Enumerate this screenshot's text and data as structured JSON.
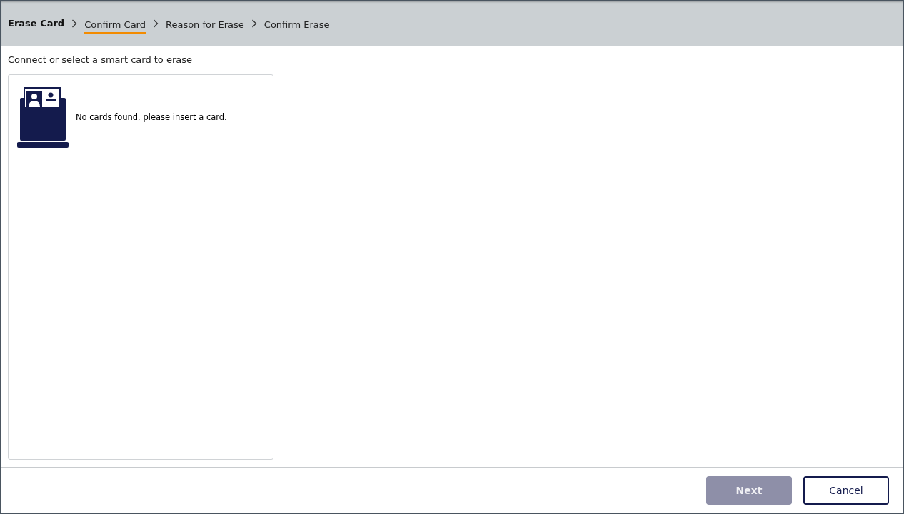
{
  "header": {
    "title": "Erase Card",
    "steps": [
      {
        "label": "Confirm Card",
        "selected": true
      },
      {
        "label": "Reason for Erase",
        "selected": false
      },
      {
        "label": "Confirm Erase",
        "selected": false
      }
    ]
  },
  "instruction": "Connect or select a smart card to erase",
  "card_panel": {
    "message": "No cards found, please insert a card."
  },
  "buttons": [
    {
      "label": "Next",
      "kind": "primary",
      "disabled": true
    },
    {
      "label": "Cancel",
      "kind": "secondary",
      "disabled": false
    }
  ]
}
